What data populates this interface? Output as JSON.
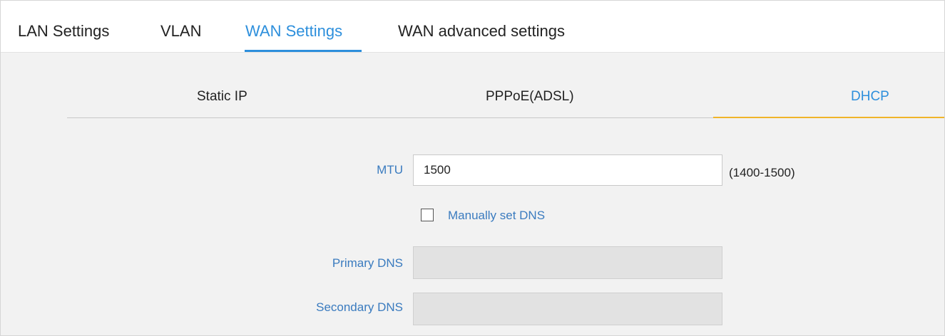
{
  "top_tabs": {
    "lan_settings": "LAN Settings",
    "vlan": "VLAN",
    "wan_settings": "WAN Settings",
    "wan_advanced": "WAN advanced settings",
    "active": "WAN Settings"
  },
  "sub_tabs": {
    "static_ip": "Static IP",
    "pppoe": "PPPoE(ADSL)",
    "dhcp": "DHCP",
    "active": "DHCP"
  },
  "form": {
    "mtu_label": "MTU",
    "mtu_value": "1500",
    "mtu_range": "(1400-1500)",
    "manual_dns_label": "Manually set DNS",
    "manual_dns_checked": false,
    "primary_dns_label": "Primary DNS",
    "primary_dns_value": "",
    "secondary_dns_label": "Secondary DNS",
    "secondary_dns_value": ""
  },
  "colors": {
    "accent_blue": "#2d8fdc",
    "label_blue": "#3a7bbf",
    "active_subtab_underline": "#f0b429"
  }
}
